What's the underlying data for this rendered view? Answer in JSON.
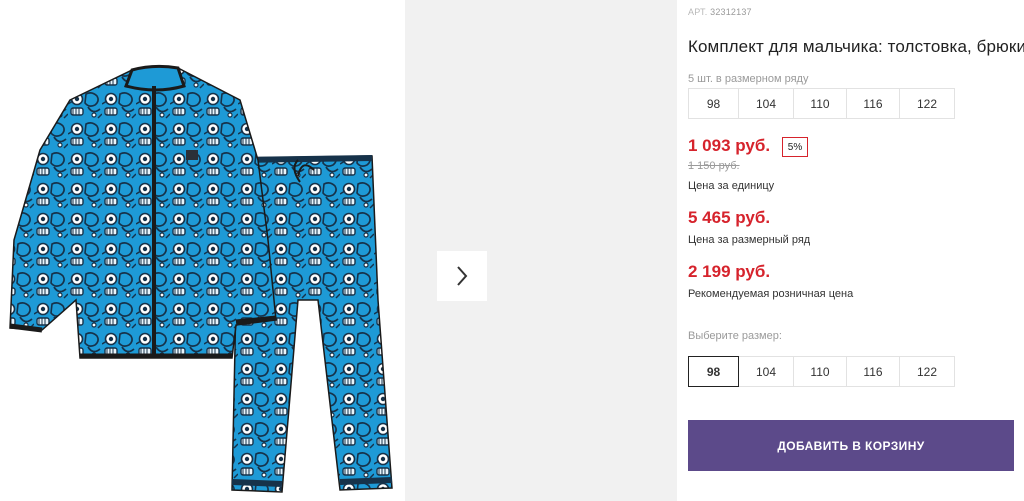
{
  "gallery": {
    "image_alt": "Комплект для мальчика: толстовка, брюки",
    "next_icon": "chevron-right-icon",
    "colors": {
      "fabric": "#1e9ad6",
      "print": "#16324a",
      "trim": "#1a1a1a",
      "side_bg": "#f1f1f1"
    }
  },
  "product": {
    "sku_label": "АРТ.",
    "sku_value": "32312137",
    "title": "Комплект для мальчика: толстовка, брюки",
    "pack_note": "5 шт. в размерном ряду",
    "pack_sizes": [
      "98",
      "104",
      "110",
      "116",
      "122"
    ]
  },
  "prices": {
    "unit_price": "1 093 руб.",
    "discount": "5%",
    "old_price": "1 150 руб.",
    "unit_label": "Цена за единицу",
    "pack_price": "5 465 руб.",
    "pack_label": "Цена за размерный ряд",
    "retail_price": "2 199 руб.",
    "retail_label": "Рекомендуемая розничная цена",
    "accent_color": "#d6232c"
  },
  "size_select": {
    "label": "Выберите размер:",
    "options": [
      "98",
      "104",
      "110",
      "116",
      "122"
    ],
    "selected": "98"
  },
  "cart": {
    "button_label": "ДОБАВИТЬ В КОРЗИНУ",
    "button_color": "#5c4a8a"
  }
}
